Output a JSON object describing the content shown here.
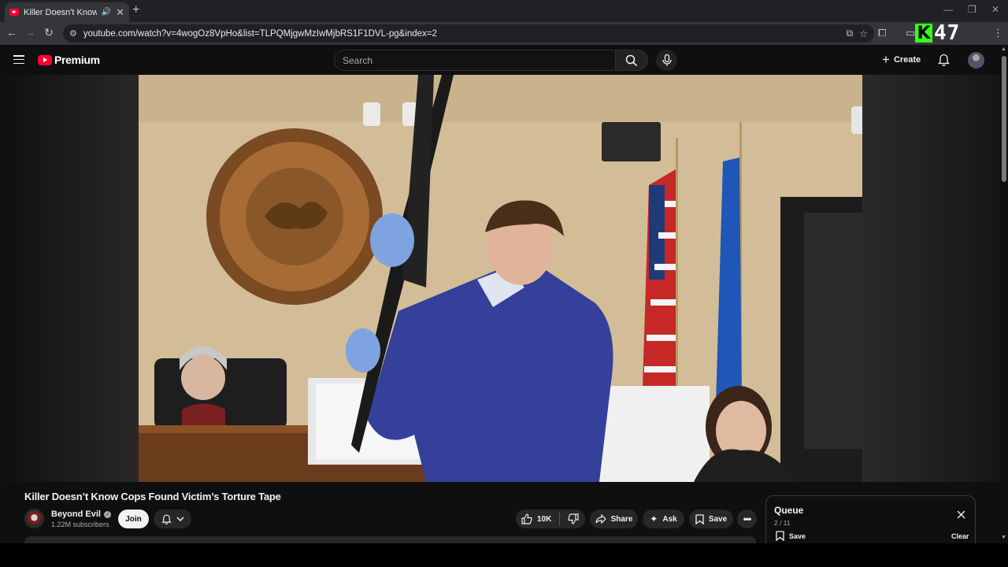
{
  "browser": {
    "tab_title": "Killer Doesn't Know Cops Fo",
    "url": "youtube.com/watch?v=4wogOz8VpHo&list=TLPQMjgwMzIwMjbRS1F1DVL-pg&index=2",
    "overlay_badge_letter": "K",
    "overlay_badge_number": "47"
  },
  "header": {
    "logo_text": "Premium",
    "search_placeholder": "Search",
    "create_label": "Create"
  },
  "video": {
    "title": "Killer Doesn’t Know Cops Found Victim’s Torture Tape"
  },
  "channel": {
    "name": "Beyond Evil",
    "subscribers": "1.22M subscribers",
    "join_label": "Join"
  },
  "actions": {
    "like_count": "10K",
    "share_label": "Share",
    "ask_label": "Ask",
    "save_label": "Save"
  },
  "queue": {
    "title": "Queue",
    "position": "2 / 11",
    "save_label": "Save",
    "clear_label": "Clear"
  },
  "colors": {
    "youtube_red": "#ff0033",
    "background": "#0f0f0f",
    "badge_green": "#39ff14"
  }
}
